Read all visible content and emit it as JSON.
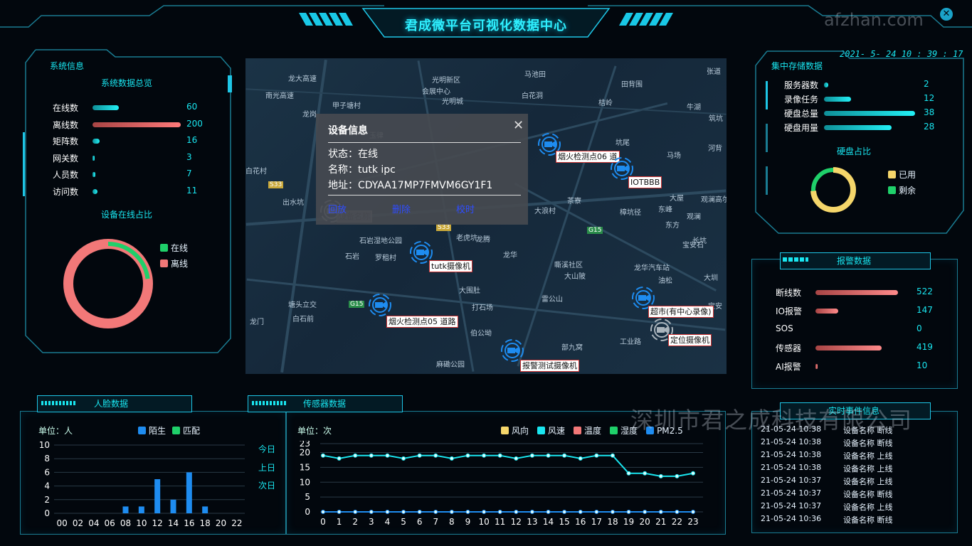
{
  "header": {
    "title": "君成微平台可视化数据中心",
    "datetime": "2021- 5- 24  10 : 39 : 17"
  },
  "watermarks": {
    "top_right": "afzhan.com",
    "bottom": "深圳市君之成科技有限公司"
  },
  "system_info": {
    "panel_title": "系统信息",
    "overview_title": "系统数据总览",
    "stats": [
      {
        "label": "在线数",
        "value": "60",
        "fraction": 0.3,
        "color": "#19e6f0"
      },
      {
        "label": "离线数",
        "value": "200",
        "fraction": 1.0,
        "color": "#f06a6a"
      },
      {
        "label": "矩阵数",
        "value": "16",
        "fraction": 0.08,
        "color": "#19e6f0"
      },
      {
        "label": "网关数",
        "value": "3",
        "fraction": 0.015,
        "color": "#19e6f0"
      },
      {
        "label": "人员数",
        "value": "7",
        "fraction": 0.035,
        "color": "#19e6f0"
      },
      {
        "label": "访问数",
        "value": "11",
        "fraction": 0.055,
        "color": "#19e6f0"
      }
    ],
    "ratio_title": "设备在线占比",
    "donut": {
      "online_fraction": 0.23,
      "legend": [
        {
          "label": "在线",
          "color": "#1fd06a"
        },
        {
          "label": "离线",
          "color": "#f27878"
        }
      ]
    }
  },
  "map": {
    "labels": [
      "光明新区",
      "会展中心",
      "光明城",
      "甲子塘村",
      "马池田",
      "白花洞",
      "桔岭",
      "田背围",
      "南光高速",
      "龙大高速",
      "白花村",
      "出水坑",
      "玉律",
      "龙岗",
      "筑坑",
      "石岩湿地公园",
      "罗租村",
      "石岩",
      "龙腾",
      "老虎坑",
      "茶寮",
      "大浪村",
      "樟坑径",
      "大屋",
      "东峰",
      "观澜",
      "坑尾",
      "马场",
      "河背",
      "嘶溪社区",
      "大山陂",
      "大圳",
      "塘头立交",
      "龙门",
      "白石前",
      "大围肚",
      "打石场",
      "伯公坳",
      "雷公山",
      "龙华",
      "龙华汽车站",
      "油松",
      "东方",
      "部九窝",
      "工业路",
      "宝安",
      "宝安石",
      "麻磡公园",
      "长坑",
      "观澜高尔夫",
      "张道",
      "牛湖"
    ],
    "road_badges": [
      "S33",
      "S33",
      "G15",
      "G15"
    ],
    "cameras": [
      {
        "label": "烟火检测点06 道"
      },
      {
        "label": "IOTBBB"
      },
      {
        "label": "tutk摄像机"
      },
      {
        "label": "烟火检测点05 道路"
      },
      {
        "label": "超市(有中心录像)"
      },
      {
        "label": "定位摄像机"
      },
      {
        "label": "报警测试摄像机"
      },
      {
        "label": "设备名称"
      }
    ],
    "popup": {
      "title": "设备信息",
      "status": "状态：在线",
      "name": "名称：tutk ipc",
      "address": "地址：CDYAA17MP7FMVM6GY1F1",
      "actions": [
        "回放",
        "删除",
        "校时"
      ]
    }
  },
  "storage": {
    "panel_title": "集中存储数据",
    "stats": [
      {
        "label": "服务器数",
        "value": "2",
        "fraction": 0.05
      },
      {
        "label": "录像任务",
        "value": "12",
        "fraction": 0.3
      },
      {
        "label": "硬盘总量",
        "value": "38",
        "fraction": 1.0
      },
      {
        "label": "硬盘用量",
        "value": "28",
        "fraction": 0.74
      }
    ],
    "disk_title": "硬盘占比",
    "donut": {
      "used_fraction": 0.74,
      "legend": [
        {
          "label": "已用",
          "color": "#f5d66a"
        },
        {
          "label": "剩余",
          "color": "#1fd06a"
        }
      ]
    }
  },
  "alarm": {
    "panel_title": "报警数据",
    "stats": [
      {
        "label": "断线数",
        "value": "522",
        "fraction": 1.0
      },
      {
        "label": "IO报警",
        "value": "147",
        "fraction": 0.28
      },
      {
        "label": "SOS",
        "value": "0",
        "fraction": 0.0
      },
      {
        "label": "传感器",
        "value": "419",
        "fraction": 0.8
      },
      {
        "label": "AI报警",
        "value": "10",
        "fraction": 0.02
      }
    ]
  },
  "face": {
    "panel_title": "人脸数据",
    "unit": "单位：人",
    "legend": [
      {
        "label": "陌生",
        "color": "#1e8cf0"
      },
      {
        "label": "匹配",
        "color": "#1fd06a"
      }
    ],
    "day_options": [
      "今日",
      "上日",
      "次日"
    ]
  },
  "sensor": {
    "panel_title": "传感器数据",
    "unit": "单位：次",
    "legend": [
      {
        "label": "风向",
        "color": "#f5d66a"
      },
      {
        "label": "风速",
        "color": "#19e6f0"
      },
      {
        "label": "温度",
        "color": "#f27878"
      },
      {
        "label": "湿度",
        "color": "#1fd06a"
      },
      {
        "label": "PM2.5",
        "color": "#1e8cf0"
      }
    ]
  },
  "events": {
    "panel_title": "实时事件信息",
    "rows": [
      {
        "time": "21-05-24 10:38",
        "text": "设备名称 断线"
      },
      {
        "time": "21-05-24 10:38",
        "text": "设备名称 断线"
      },
      {
        "time": "21-05-24 10:38",
        "text": "设备名称 上线"
      },
      {
        "time": "21-05-24 10:38",
        "text": "设备名称 上线"
      },
      {
        "time": "21-05-24 10:37",
        "text": "设备名称 上线"
      },
      {
        "time": "21-05-24 10:37",
        "text": "设备名称 断线"
      },
      {
        "time": "21-05-24 10:37",
        "text": "设备名称 上线"
      },
      {
        "time": "21-05-24 10:36",
        "text": "设备名称 断线"
      }
    ]
  },
  "chart_data": [
    {
      "type": "bar",
      "categories": [
        "00",
        "02",
        "04",
        "06",
        "08",
        "10",
        "12",
        "14",
        "16",
        "18",
        "20",
        "22"
      ],
      "series": [
        {
          "name": "陌生",
          "values": [
            0,
            0,
            0,
            0,
            1,
            1,
            5,
            2,
            6,
            1,
            0,
            0
          ]
        },
        {
          "name": "匹配",
          "values": [
            0,
            0,
            0,
            0,
            0,
            0,
            0,
            0,
            0,
            0,
            0,
            0
          ]
        }
      ],
      "ylim": [
        0,
        10
      ],
      "yticks": [
        0,
        2,
        4,
        6,
        8,
        10
      ],
      "grid": true,
      "legend": "top"
    },
    {
      "type": "line",
      "x": [
        0,
        1,
        2,
        3,
        4,
        5,
        6,
        7,
        8,
        9,
        10,
        11,
        12,
        13,
        14,
        15,
        16,
        17,
        18,
        19,
        20,
        21,
        22,
        23
      ],
      "series": [
        {
          "name": "温度",
          "values": [
            19,
            18,
            19,
            19,
            19,
            18,
            19,
            19,
            18,
            19,
            19,
            19,
            18,
            19,
            19,
            19,
            18,
            19,
            19,
            13,
            13,
            12,
            12,
            13
          ]
        },
        {
          "name": "PM2.5",
          "values": [
            0,
            0,
            0,
            0,
            0,
            0,
            0,
            0,
            0,
            0,
            0,
            0,
            0,
            0,
            0,
            0,
            0,
            0,
            0,
            0,
            0,
            0,
            0,
            0
          ]
        }
      ],
      "ylim": [
        0,
        23
      ],
      "yticks": [
        0,
        5,
        10,
        15,
        20,
        23
      ],
      "grid": true,
      "legend": "top"
    }
  ]
}
